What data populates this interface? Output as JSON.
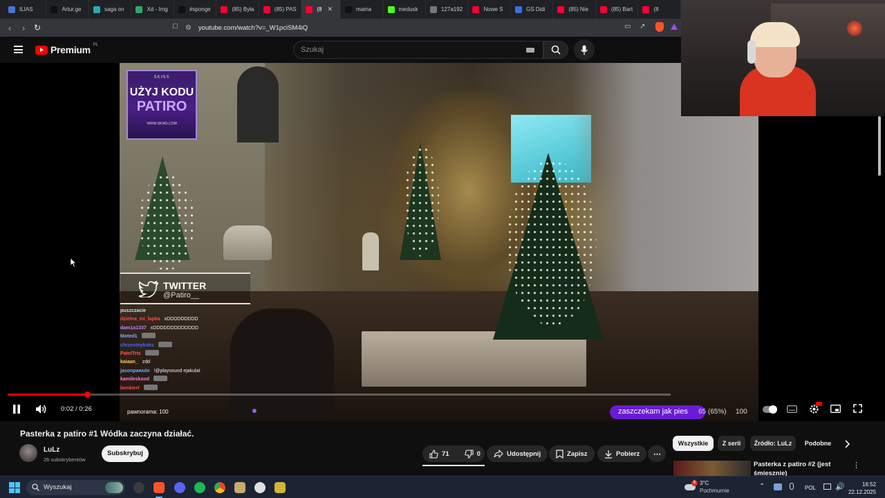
{
  "browser": {
    "tabs": [
      {
        "label": "ILIAS",
        "color": "#4a72d8"
      },
      {
        "label": "Artur.ge",
        "color": "#111111"
      },
      {
        "label": "saga on",
        "color": "#2aa7b8"
      },
      {
        "label": "Xd - Img",
        "color": "#2fa86a"
      },
      {
        "label": "#sponge",
        "color": "#111111"
      },
      {
        "label": "(85) Była",
        "color": "#ff0033"
      },
      {
        "label": "(85) PAS",
        "color": "#ff0033"
      },
      {
        "label": "(8",
        "color": "#ff0033",
        "active": true
      },
      {
        "label": "mama",
        "color": "#111111"
      },
      {
        "label": "medusk",
        "color": "#53fc18"
      },
      {
        "label": "127a192",
        "color": "#777777"
      },
      {
        "label": "Nowe S",
        "color": "#ff0033"
      },
      {
        "label": "GS Didi",
        "color": "#3b6fe0"
      },
      {
        "label": "(85) Nie",
        "color": "#ff0033"
      },
      {
        "label": "(85) Bart",
        "color": "#ff0033"
      },
      {
        "label": "(8",
        "color": "#ff0033"
      }
    ],
    "url": "youtube.com/watch?v=_W1pclSM4iQ"
  },
  "header": {
    "logo_text": "Premium",
    "logo_badge": "PL",
    "search_placeholder": "Szukaj"
  },
  "video_overlay": {
    "promo": {
      "brand": "SKINS",
      "line1": "UŻYJ KODU",
      "line2": "PATIRO",
      "site": "WWW.SKINS.COM"
    },
    "twitter": {
      "title": "TWITTER",
      "handle": "@Patiro__"
    },
    "chat": [
      {
        "name": "puszczacie",
        "msg": "",
        "color": "#dddddd"
      },
      {
        "name": "dzielna_mi_lapka",
        "msg": "xDDDDDDDDD",
        "color": "#ff4a4a"
      },
      {
        "name": "dam1a1337",
        "msg": "xDDDDDDDDDDDDD",
        "color": "#c285ff"
      },
      {
        "name": "Moted1",
        "msg": "",
        "color": "#7fa7ff",
        "emote": true
      },
      {
        "name": "chrzestnykoks",
        "msg": "",
        "color": "#3c6bff",
        "emote": true
      },
      {
        "name": "PateiTrts",
        "msg": "",
        "color": "#ff5a5a",
        "emote": true
      },
      {
        "name": "kaiaan_",
        "msg": "zdd",
        "color": "#ffd34a"
      },
      {
        "name": "jasonpawulo",
        "msg": "!@playsound ejakulat",
        "color": "#6ea8ff"
      },
      {
        "name": "kamileskoxd",
        "msg": "",
        "color": "#ff80c8",
        "emote": true
      },
      {
        "name": "bonkiert",
        "msg": "",
        "color": "#ff4a4a",
        "emote": true
      }
    ]
  },
  "player": {
    "time": "0:02 / 0:26",
    "progress": 0.12,
    "chat_bar_text": "pawnorama: 100",
    "alert_text": "zaszczekam jak pies",
    "alert_pct": "65 (65%)",
    "alert_volume": "100"
  },
  "video_info": {
    "title": "Pasterka z patiro #1 Wódka zaczyna działać.",
    "channel_name": "LuLz",
    "subscribers": "26 subskrybentów",
    "subscribe_label": "Subskrybuj",
    "likes": "71",
    "dislikes": "0",
    "share_label": "Udostępnij",
    "save_label": "Zapisz",
    "download_label": "Pobierz",
    "more_label": "⋯"
  },
  "sidebar": {
    "chips": [
      "Wszystkie",
      "Z serii",
      "Źródło: LuLz",
      "Podobne"
    ],
    "related_title": "Pasterka z patiro #2 (jest śmiesznie)"
  },
  "taskbar": {
    "search_label": "Wyszukaj",
    "weather_temp": "3°C",
    "weather_cond": "Pochmurnie",
    "weather_badge": "6",
    "lang": "POL",
    "time": "16:52",
    "date": "22.12.2025"
  }
}
